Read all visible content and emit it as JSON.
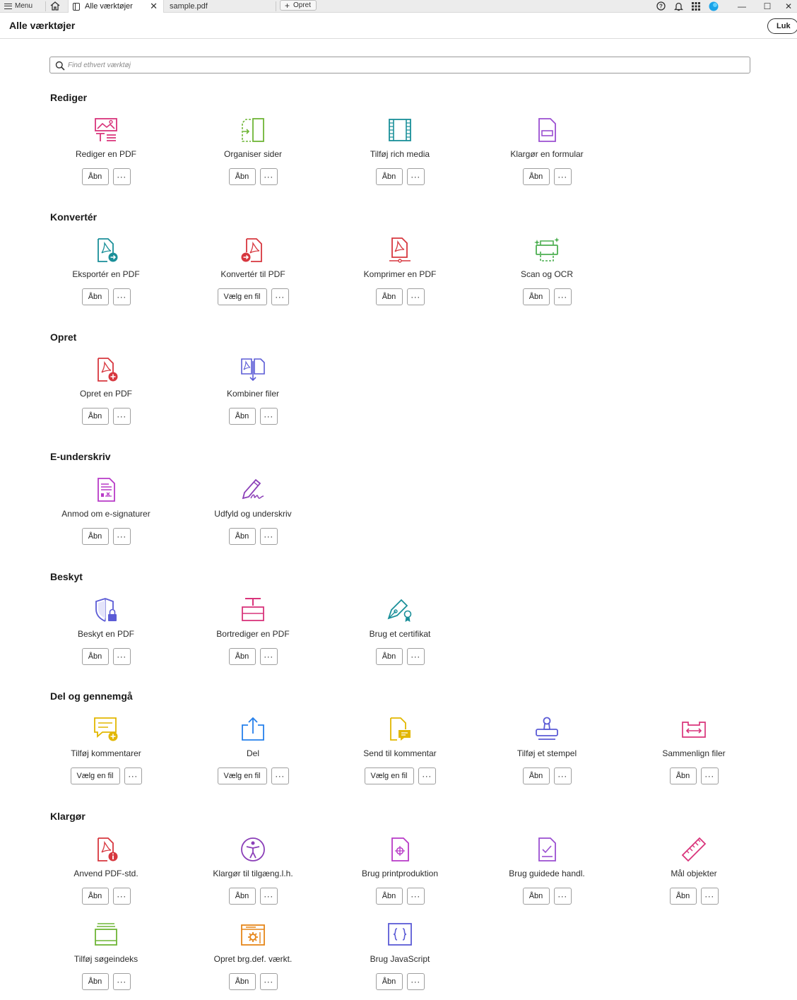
{
  "tabbar": {
    "menu_label": "Menu",
    "active_tab_label": "Alle værktøjer",
    "file_tab_label": "sample.pdf",
    "new_tab_label": "Opret"
  },
  "header": {
    "title": "Alle værktøjer",
    "close_label": "Luk"
  },
  "search": {
    "placeholder": "Find ethvert værktøj"
  },
  "sections": [
    {
      "title": "Rediger",
      "tools": [
        {
          "label": "Rediger en PDF",
          "button": "Åbn",
          "icon": "edit-pdf-icon"
        },
        {
          "label": "Organiser sider",
          "button": "Åbn",
          "icon": "organize-pages-icon"
        },
        {
          "label": "Tilføj rich media",
          "button": "Åbn",
          "icon": "rich-media-icon"
        },
        {
          "label": "Klargør en formular",
          "button": "Åbn",
          "icon": "prepare-form-icon"
        }
      ]
    },
    {
      "title": "Konvertér",
      "tools": [
        {
          "label": "Eksportér en PDF",
          "button": "Åbn",
          "icon": "export-pdf-icon"
        },
        {
          "label": "Konvertér til PDF",
          "button": "Vælg en fil",
          "icon": "convert-to-pdf-icon"
        },
        {
          "label": "Komprimer en PDF",
          "button": "Åbn",
          "icon": "compress-pdf-icon"
        },
        {
          "label": "Scan og OCR",
          "button": "Åbn",
          "icon": "scan-ocr-icon"
        }
      ]
    },
    {
      "title": "Opret",
      "tools": [
        {
          "label": "Opret en PDF",
          "button": "Åbn",
          "icon": "create-pdf-icon"
        },
        {
          "label": "Kombiner filer",
          "button": "Åbn",
          "icon": "combine-files-icon"
        }
      ]
    },
    {
      "title": "E-underskriv",
      "tools": [
        {
          "label": "Anmod om e-signaturer",
          "button": "Åbn",
          "icon": "request-esign-icon"
        },
        {
          "label": "Udfyld og underskriv",
          "button": "Åbn",
          "icon": "fill-sign-icon"
        }
      ]
    },
    {
      "title": "Beskyt",
      "tools": [
        {
          "label": "Beskyt en PDF",
          "button": "Åbn",
          "icon": "protect-pdf-icon"
        },
        {
          "label": "Bortrediger en PDF",
          "button": "Åbn",
          "icon": "redact-pdf-icon"
        },
        {
          "label": "Brug et certifikat",
          "button": "Åbn",
          "icon": "certificate-icon"
        }
      ]
    },
    {
      "title": "Del og gennemgå",
      "tools": [
        {
          "label": "Tilføj kommentarer",
          "button": "Vælg en fil",
          "icon": "add-comments-icon"
        },
        {
          "label": "Del",
          "button": "Vælg en fil",
          "icon": "share-icon"
        },
        {
          "label": "Send til kommentar",
          "button": "Vælg en fil",
          "icon": "send-for-comment-icon"
        },
        {
          "label": "Tilføj et stempel",
          "button": "Åbn",
          "icon": "stamp-icon"
        },
        {
          "label": "Sammenlign filer",
          "button": "Åbn",
          "icon": "compare-files-icon"
        }
      ]
    },
    {
      "title": "Klargør",
      "tools": [
        {
          "label": "Anvend PDF-std.",
          "button": "Åbn",
          "icon": "pdf-standards-icon"
        },
        {
          "label": "Klargør til tilgæng.l.h.",
          "button": "Åbn",
          "icon": "accessibility-icon"
        },
        {
          "label": "Brug printproduktion",
          "button": "Åbn",
          "icon": "print-production-icon"
        },
        {
          "label": "Brug guidede handl.",
          "button": "Åbn",
          "icon": "guided-actions-icon"
        },
        {
          "label": "Mål objekter",
          "button": "Åbn",
          "icon": "measure-icon"
        },
        {
          "label": "Tilføj søgeindeks",
          "button": "Åbn",
          "icon": "search-index-icon"
        },
        {
          "label": "Opret brg.def. værkt.",
          "button": "Åbn",
          "icon": "custom-tool-icon"
        },
        {
          "label": "Brug JavaScript",
          "button": "Åbn",
          "icon": "javascript-icon"
        }
      ]
    }
  ],
  "more_label": "···"
}
